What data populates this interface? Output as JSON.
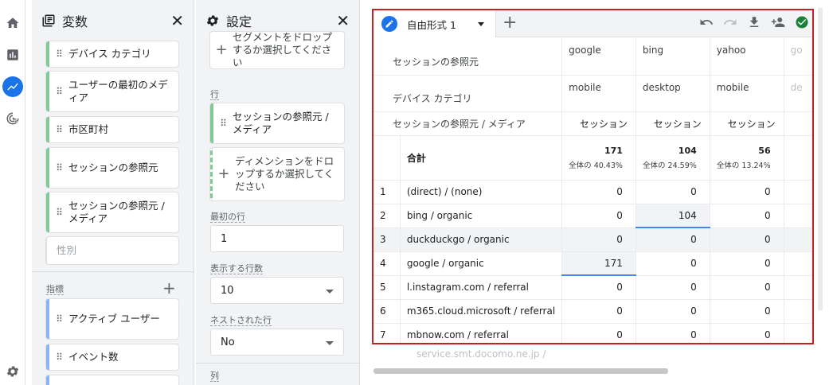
{
  "rail": {
    "icons": [
      "home-icon",
      "reports-icon",
      "explore-icon",
      "advertising-icon",
      "settings-icon"
    ]
  },
  "variables": {
    "title": "変数",
    "dimensions": [
      "デバイス カテゴリ",
      "ユーザーの最初のメディア",
      "市区町村",
      "セッションの参照元",
      "セッションの参照元 / メディア"
    ],
    "dim_ghost": "性別",
    "metrics_section": "指標",
    "metrics": [
      "アクティブ ユーザー",
      "イベント数"
    ]
  },
  "settings": {
    "title": "設定",
    "segment_drop": "セグメントをドロップするか選択してください",
    "rows_section": "行",
    "row_chip": "セッションの参照元 / メディア",
    "row_drop": "ディメンションをドロップするか選択してください",
    "first_row_label": "最初の行",
    "first_row_value": "1",
    "show_rows_label": "表示する行数",
    "show_rows_value": "10",
    "nested_label": "ネストされた行",
    "nested_value": "No",
    "cols_section": "列"
  },
  "report": {
    "tab_name": "自由形式 1",
    "header1_label": "セッションの参照元",
    "header2_label": "デバイス カテゴリ",
    "header3_label": "セッションの参照元 / メディア",
    "col_sources": [
      "google",
      "bing",
      "yahoo",
      "go"
    ],
    "col_devices": [
      "mobile",
      "desktop",
      "mobile",
      "de"
    ],
    "metric_name": "セッション",
    "total_label": "合計",
    "totals": [
      {
        "value": "171",
        "pct": "全体の 40.43%"
      },
      {
        "value": "104",
        "pct": "全体の 24.59%"
      },
      {
        "value": "56",
        "pct": "全体の 13.24%"
      }
    ],
    "rows": [
      {
        "idx": "1",
        "name": "(direct) / (none)",
        "v": [
          "0",
          "0",
          "0"
        ]
      },
      {
        "idx": "2",
        "name": "bing / organic",
        "v": [
          "0",
          "104",
          "0"
        ]
      },
      {
        "idx": "3",
        "name": "duckduckgo / organic",
        "v": [
          "0",
          "0",
          "0"
        ]
      },
      {
        "idx": "4",
        "name": "google / organic",
        "v": [
          "171",
          "0",
          "0"
        ]
      },
      {
        "idx": "5",
        "name": "l.instagram.com / referral",
        "v": [
          "0",
          "0",
          "0"
        ]
      },
      {
        "idx": "6",
        "name": "m365.cloud.microsoft / referral",
        "v": [
          "0",
          "0",
          "0"
        ]
      },
      {
        "idx": "7",
        "name": "mbnow.com / referral",
        "v": [
          "0",
          "0",
          "0"
        ]
      }
    ],
    "ghost_row": "service.smt.docomo.ne.jp /"
  }
}
